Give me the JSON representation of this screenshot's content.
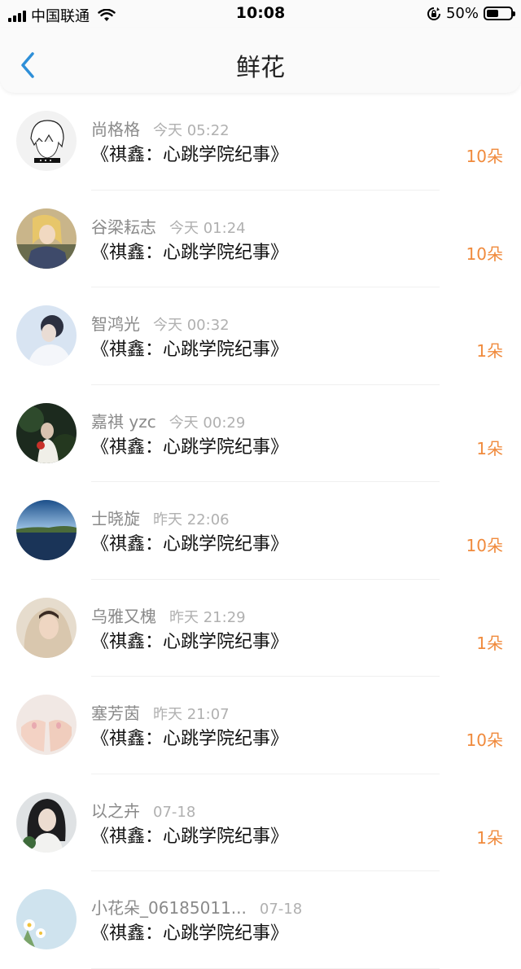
{
  "status_bar": {
    "carrier": "中国联通",
    "time": "10:08",
    "battery": "50%",
    "battery_level": 0.5,
    "icons": [
      "signal-icon",
      "wifi-icon",
      "rotation-lock-icon",
      "battery-icon"
    ]
  },
  "nav": {
    "title": "鲜花",
    "back_icon": "chevron-left-icon"
  },
  "colors": {
    "accent": "#2e8fd8",
    "count": "#f08a3c",
    "name": "#8a8a8a",
    "time": "#b0b0b0"
  },
  "items": [
    {
      "name": "尚格格",
      "time": "今天 05:22",
      "book": "《祺鑫：心跳学院纪事》",
      "count": "10朵"
    },
    {
      "name": "谷梁耘志",
      "time": "今天 01:24",
      "book": "《祺鑫：心跳学院纪事》",
      "count": "10朵"
    },
    {
      "name": "智鸿光",
      "time": "今天 00:32",
      "book": "《祺鑫：心跳学院纪事》",
      "count": "1朵"
    },
    {
      "name": "嘉祺 yzc",
      "time": "今天 00:29",
      "book": "《祺鑫：心跳学院纪事》",
      "count": "1朵"
    },
    {
      "name": "士晓旋",
      "time": "昨天 22:06",
      "book": "《祺鑫：心跳学院纪事》",
      "count": "10朵"
    },
    {
      "name": "乌雅又槐",
      "time": "昨天 21:29",
      "book": "《祺鑫：心跳学院纪事》",
      "count": "1朵"
    },
    {
      "name": "塞芳茵",
      "time": "昨天 21:07",
      "book": "《祺鑫：心跳学院纪事》",
      "count": "10朵"
    },
    {
      "name": "以之卉",
      "time": "07-18",
      "book": "《祺鑫：心跳学院纪事》",
      "count": "1朵"
    },
    {
      "name": "小花朵_06185011...",
      "time": "07-18",
      "book": "《祺鑫：心跳学院纪事》",
      "count": ""
    }
  ]
}
